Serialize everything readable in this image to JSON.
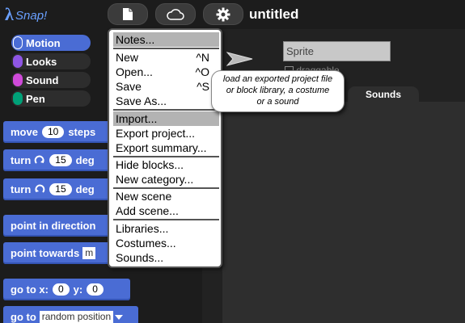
{
  "app": {
    "logo_text": "Snap!",
    "project_title": "untitled"
  },
  "toolbar": {
    "file_icon": "file-icon",
    "cloud_icon": "cloud-icon",
    "settings_icon": "gear-icon"
  },
  "categories": [
    {
      "label": "Motion",
      "color": "#4a6cd4"
    },
    {
      "label": "Looks",
      "color": "#8f56e3"
    },
    {
      "label": "Sound",
      "color": "#cf4ad9"
    },
    {
      "label": "Pen",
      "color": "#00a178"
    }
  ],
  "blocks": {
    "move": {
      "label": "move",
      "value": "10",
      "suffix": "steps"
    },
    "turn_cw": {
      "label": "turn",
      "value": "15",
      "suffix": "deg"
    },
    "turn_ccw": {
      "label": "turn",
      "value": "15",
      "suffix": "deg"
    },
    "point_direction": {
      "label": "point in direction"
    },
    "point_towards": {
      "label": "point towards",
      "value": "m"
    },
    "go_to_xy": {
      "label": "go to x:",
      "x": "0",
      "y_label": "y:",
      "y": "0"
    },
    "go_to": {
      "label": "go to",
      "value": "random position"
    }
  },
  "sprite": {
    "name": "Sprite",
    "draggable_label": "draggable"
  },
  "tabs": {
    "sounds": "Sounds"
  },
  "file_menu": {
    "items": [
      {
        "label": "Notes...",
        "shortcut": ""
      },
      {
        "label": "New",
        "shortcut": "^N"
      },
      {
        "label": "Open...",
        "shortcut": "^O"
      },
      {
        "label": "Save",
        "shortcut": "^S"
      },
      {
        "label": "Save As...",
        "shortcut": ""
      },
      {
        "label": "Import...",
        "shortcut": ""
      },
      {
        "label": "Export project...",
        "shortcut": ""
      },
      {
        "label": "Export summary...",
        "shortcut": ""
      },
      {
        "label": "Hide blocks...",
        "shortcut": ""
      },
      {
        "label": "New category...",
        "shortcut": ""
      },
      {
        "label": "New scene",
        "shortcut": ""
      },
      {
        "label": "Add scene...",
        "shortcut": ""
      },
      {
        "label": "Libraries...",
        "shortcut": ""
      },
      {
        "label": "Costumes...",
        "shortcut": ""
      },
      {
        "label": "Sounds...",
        "shortcut": ""
      }
    ],
    "highlighted": [
      "Notes...",
      "Import..."
    ]
  },
  "tooltip": {
    "line1": "load an exported project file",
    "line2": "or block library, a costume",
    "line3": "or a sound"
  },
  "colors": {
    "motion_block": "#4a6cd4",
    "menu_highlight": "#b3b3b3",
    "background": "#141414"
  }
}
